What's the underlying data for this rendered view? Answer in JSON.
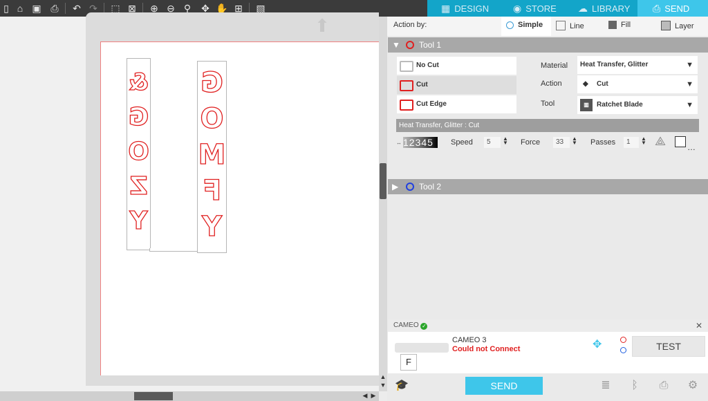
{
  "tabs": [
    {
      "label": "DESIGN",
      "icon": "grid-icon"
    },
    {
      "label": "STORE",
      "icon": "store-icon"
    },
    {
      "label": "LIBRARY",
      "icon": "cloud-icon"
    },
    {
      "label": "SEND",
      "icon": "send-icon"
    }
  ],
  "canvas": {
    "strip1": [
      "Y",
      "Z",
      "O",
      "G",
      "&"
    ],
    "strip2": [
      "Y",
      "F",
      "M",
      "O",
      "G"
    ]
  },
  "action": {
    "label": "Action by:",
    "options": [
      "Simple",
      "Line",
      "Fill",
      "Layer"
    ],
    "selected": "Simple"
  },
  "tool1": {
    "title": "Tool 1",
    "color": "#e02020",
    "cut_options": [
      "No Cut",
      "Cut",
      "Cut Edge"
    ],
    "selected_cut": "Cut",
    "material_label": "Material",
    "material_value": "Heat Transfer, Glitter",
    "action_label": "Action",
    "action_value": "Cut",
    "tool_label": "Tool",
    "tool_value": "Ratchet Blade",
    "strip_text": "Heat Transfer, Glitter : Cut",
    "depth_digits": "12345",
    "speed_label": "Speed",
    "speed_value": "5",
    "force_label": "Force",
    "force_value": "33",
    "passes_label": "Passes",
    "passes_value": "1"
  },
  "tool2": {
    "title": "Tool 2",
    "color": "#2040e0"
  },
  "device": {
    "header": "CAMEO",
    "name": "CAMEO 3",
    "status": "Could not Connect",
    "preview_letter": "F",
    "test_label": "TEST",
    "send_label": "SEND"
  }
}
